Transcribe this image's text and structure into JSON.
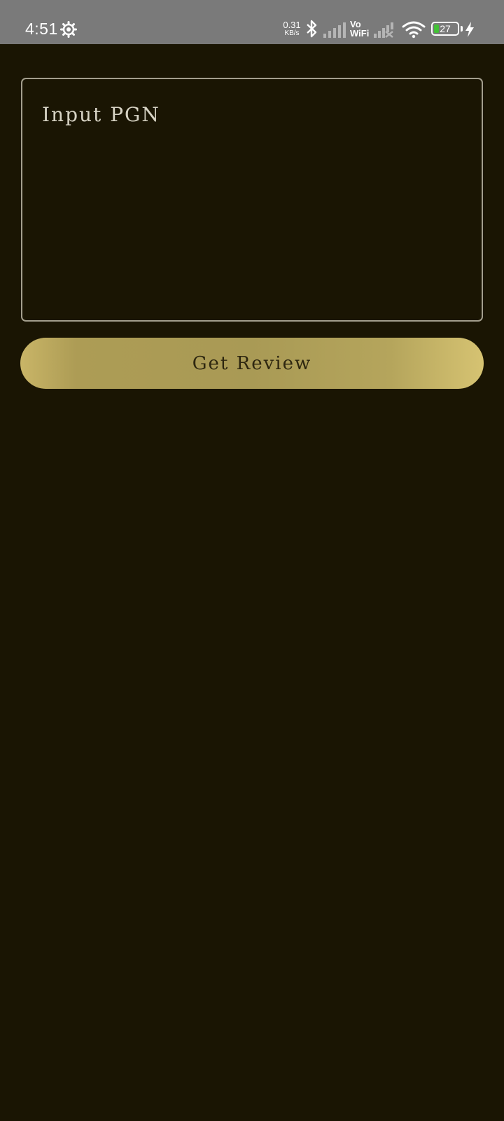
{
  "status_bar": {
    "time": "4:51",
    "net_speed_value": "0.31",
    "net_speed_unit": "KB/s",
    "vo_label": "Vo",
    "wifi_label": "WiFi",
    "battery_level": "27",
    "icons": [
      "gear-icon",
      "bluetooth-icon",
      "signal-bars-icon",
      "signal-bars-no-service-icon",
      "wifi-icon",
      "battery-icon",
      "charging-bolt-icon"
    ],
    "battery_fill_color": "#43c136"
  },
  "pgn": {
    "placeholder": "Input PGN",
    "value": ""
  },
  "actions": {
    "review_label": "Get Review"
  },
  "colors": {
    "background": "#1a1503",
    "input_border": "#a39e8d",
    "button_gold": "#a99a55",
    "button_text": "#2e2710"
  }
}
